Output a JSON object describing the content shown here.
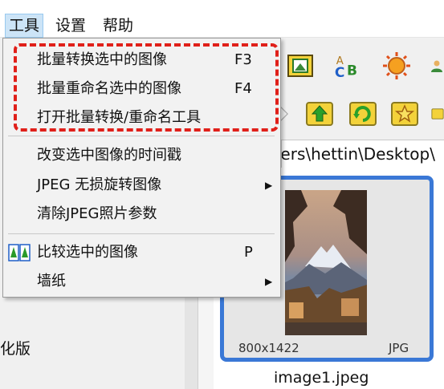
{
  "menubar": {
    "items": [
      {
        "label": "工具",
        "active": true
      },
      {
        "label": "设置",
        "active": false
      },
      {
        "label": "帮助",
        "active": false
      }
    ]
  },
  "dropdown": {
    "items": [
      {
        "label": "批量转换选中的图像",
        "shortcut": "F3"
      },
      {
        "label": "批量重命名选中的图像",
        "shortcut": "F4"
      },
      {
        "label": "打开批量转换/重命名工具",
        "shortcut": ""
      },
      {
        "label": "改变选中图像的时间戳",
        "shortcut": ""
      },
      {
        "label": "JPEG 无损旋转图像",
        "shortcut": "",
        "submenu": true
      },
      {
        "label": "清除JPEG照片参数",
        "shortcut": ""
      },
      {
        "label": "比较选中的图像",
        "shortcut": "P",
        "icon": "compare-trees-icon"
      },
      {
        "label": "墙纸",
        "shortcut": "",
        "submenu": true
      }
    ],
    "highlight_color": "#e0201a"
  },
  "address_bar": {
    "path_text": "sers\\hettin\\Desktop\\"
  },
  "thumbnail": {
    "resolution": "800x1422",
    "format": "JPG",
    "filename": "image1.jpeg",
    "border_color": "#3a78d6"
  },
  "left_pane": {
    "partial_text": "化版"
  },
  "toolbar": {
    "icons": [
      "crop-icon",
      "text-abc-icon",
      "sun-icon",
      "user-icon",
      "star-diamond-icon",
      "up-folder-icon",
      "refresh-icon",
      "favorite-star-icon",
      "folder-icon"
    ]
  }
}
